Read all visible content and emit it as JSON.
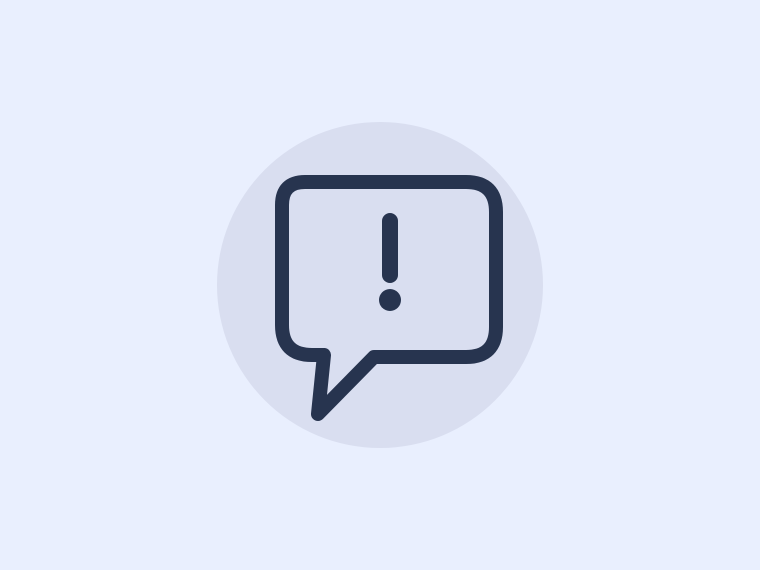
{
  "colors": {
    "background": "#E9EFFE",
    "circle": "#D9DEF0",
    "icon_stroke": "#27344F"
  },
  "icon": {
    "name": "speech-bubble-exclamation-icon"
  }
}
